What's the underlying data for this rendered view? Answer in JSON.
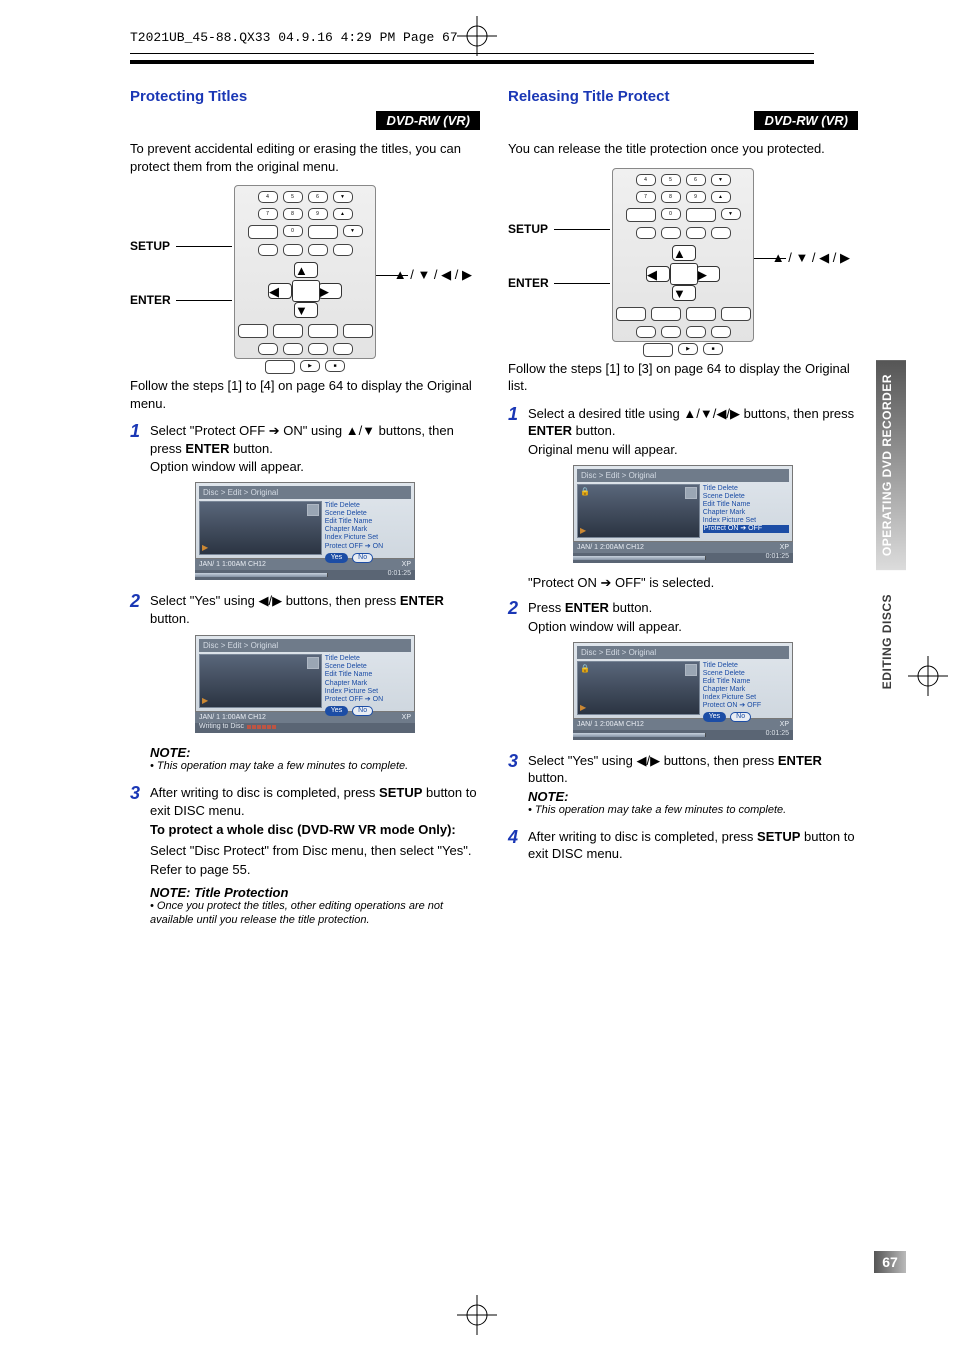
{
  "header_line": "T2021UB_45-88.QX33  04.9.16  4:29 PM  Page 67",
  "side_tab_top": "OPERATING DVD RECORDER",
  "side_tab_bottom": "EDITING DISCS",
  "page_number": "67",
  "badge": "DVD-RW (VR)",
  "remote": {
    "setup_label": "SETUP",
    "enter_label": "ENTER",
    "arrow_cluster": "▲ / ▼ / ◀ / ▶"
  },
  "osd_menu": {
    "breadcrumb": "Disc > Edit > Original",
    "items": [
      "Title Delete",
      "Scene Delete",
      "Edit Title Name",
      "Chapter Mark",
      "Index Picture Set"
    ],
    "yes": "Yes",
    "no": "No",
    "status_a_left": "JAN/ 1  1:00AM  CH12",
    "status_b_left": "JAN/ 1  2:00AM  CH12",
    "status_right": "XP",
    "time": "0:01:25",
    "writing": "Writing to Disc"
  },
  "protect": {
    "title": "Protecting Titles",
    "intro": "To prevent accidental editing or erasing the titles, you can protect them from the original menu.",
    "follow": "Follow the steps [1] to [4] on page 64 to display the Original menu.",
    "step1_a": "Select \"Protect OFF ",
    "step1_b": " ON\" using ",
    "step1_c": " buttons, then press ",
    "step1_enter": "ENTER",
    "step1_d": " button.",
    "step1_sub": "Option window will appear.",
    "osd1_last": "Protect OFF ➔ ON",
    "step2_a": "Select \"Yes\" using ",
    "step2_b": " buttons, then press ",
    "step2_enter": "ENTER",
    "step2_c": " button.",
    "note_label": "NOTE:",
    "note_body": "• This operation may take a few minutes to complete.",
    "step3_a": "After writing to disc is completed, press ",
    "step3_setup": "SETUP",
    "step3_b": " button to exit DISC menu.",
    "whole_disc": "To protect a whole disc (DVD-RW VR mode Only):",
    "whole_disc_body_1": "Select \"Disc Protect\" from Disc menu, then select \"Yes\".",
    "whole_disc_body_2": "Refer to page 55.",
    "note2_title": "NOTE: Title Protection",
    "note2_body": "• Once you protect the titles, other editing operations are not available until you release the title protection."
  },
  "release": {
    "title": "Releasing Title Protect",
    "intro": "You can release the title protection once you protected.",
    "follow": "Follow the steps [1] to [3] on page 64 to display the Original list.",
    "step1_a": "Select a desired title using ",
    "step1_b": " buttons, then press ",
    "step1_enter": "ENTER",
    "step1_c": " button.",
    "step1_sub": "Original menu will appear.",
    "osd1_last": "Protect ON ➔ OFF",
    "middle_line": "\"Protect ON ➔ OFF\" is selected.",
    "step2_a": "Press ",
    "step2_enter": "ENTER",
    "step2_b": " button.",
    "step2_sub": "Option window will appear.",
    "step3_a": "Select \"Yes\" using ",
    "step3_b": " buttons, then press ",
    "step3_enter": "ENTER",
    "step3_c": " button.",
    "note_label": "NOTE:",
    "note_body": "• This operation may take a few minutes to complete.",
    "step4_a": "After writing to disc is completed, press ",
    "step4_setup": "SETUP",
    "step4_b": " button to exit DISC menu."
  }
}
